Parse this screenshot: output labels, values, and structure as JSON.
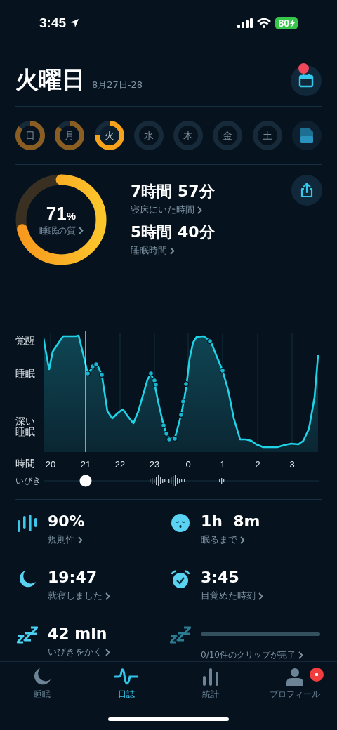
{
  "status_bar": {
    "time": "3:45",
    "battery": "80"
  },
  "header": {
    "title": "火曜日",
    "date_range": "8月27日-28",
    "calendar_badge": true
  },
  "week": [
    {
      "label": "日",
      "selected": false
    },
    {
      "label": "月",
      "selected": false
    },
    {
      "label": "火",
      "selected": true
    },
    {
      "label": "水",
      "selected": false
    },
    {
      "label": "木",
      "selected": false
    },
    {
      "label": "金",
      "selected": false
    },
    {
      "label": "土",
      "selected": false
    }
  ],
  "summary": {
    "quality": {
      "value": "71",
      "unit": "%",
      "label": "睡眠の質"
    },
    "metrics": [
      {
        "value": "7時間 57分",
        "label": "寝床にいた時間"
      },
      {
        "value": "5時間 40分",
        "label": "睡眠時間"
      }
    ]
  },
  "chart": {
    "y_labels": [
      "覚醒",
      "睡眠",
      "深い睡眠"
    ],
    "x_axis_label": "時間",
    "x_labels": [
      "20",
      "21",
      "22",
      "23",
      "0",
      "1",
      "2",
      "3"
    ],
    "snore_label": "いびき"
  },
  "stats": [
    {
      "kind": "stat",
      "value": "90%",
      "label": "規則性"
    },
    {
      "kind": "stat",
      "value": "1h  8m",
      "label": "眠るまで"
    },
    {
      "kind": "stat",
      "value": "19:47",
      "label": "就寝しました"
    },
    {
      "kind": "stat",
      "value": "3:45",
      "label": "目覚めた時刻"
    },
    {
      "kind": "stat",
      "value": "42 min",
      "label": "いびきをかく"
    },
    {
      "kind": "progress",
      "level": 0,
      "label": "0/10件のクリップが完了"
    }
  ],
  "tabs": [
    {
      "label": "睡眠",
      "selected": false,
      "badge": false
    },
    {
      "label": "日誌",
      "selected": true,
      "badge": false
    },
    {
      "label": "統計",
      "selected": false,
      "badge": false
    },
    {
      "label": "プロフィール",
      "selected": false,
      "badge": true
    }
  ]
}
